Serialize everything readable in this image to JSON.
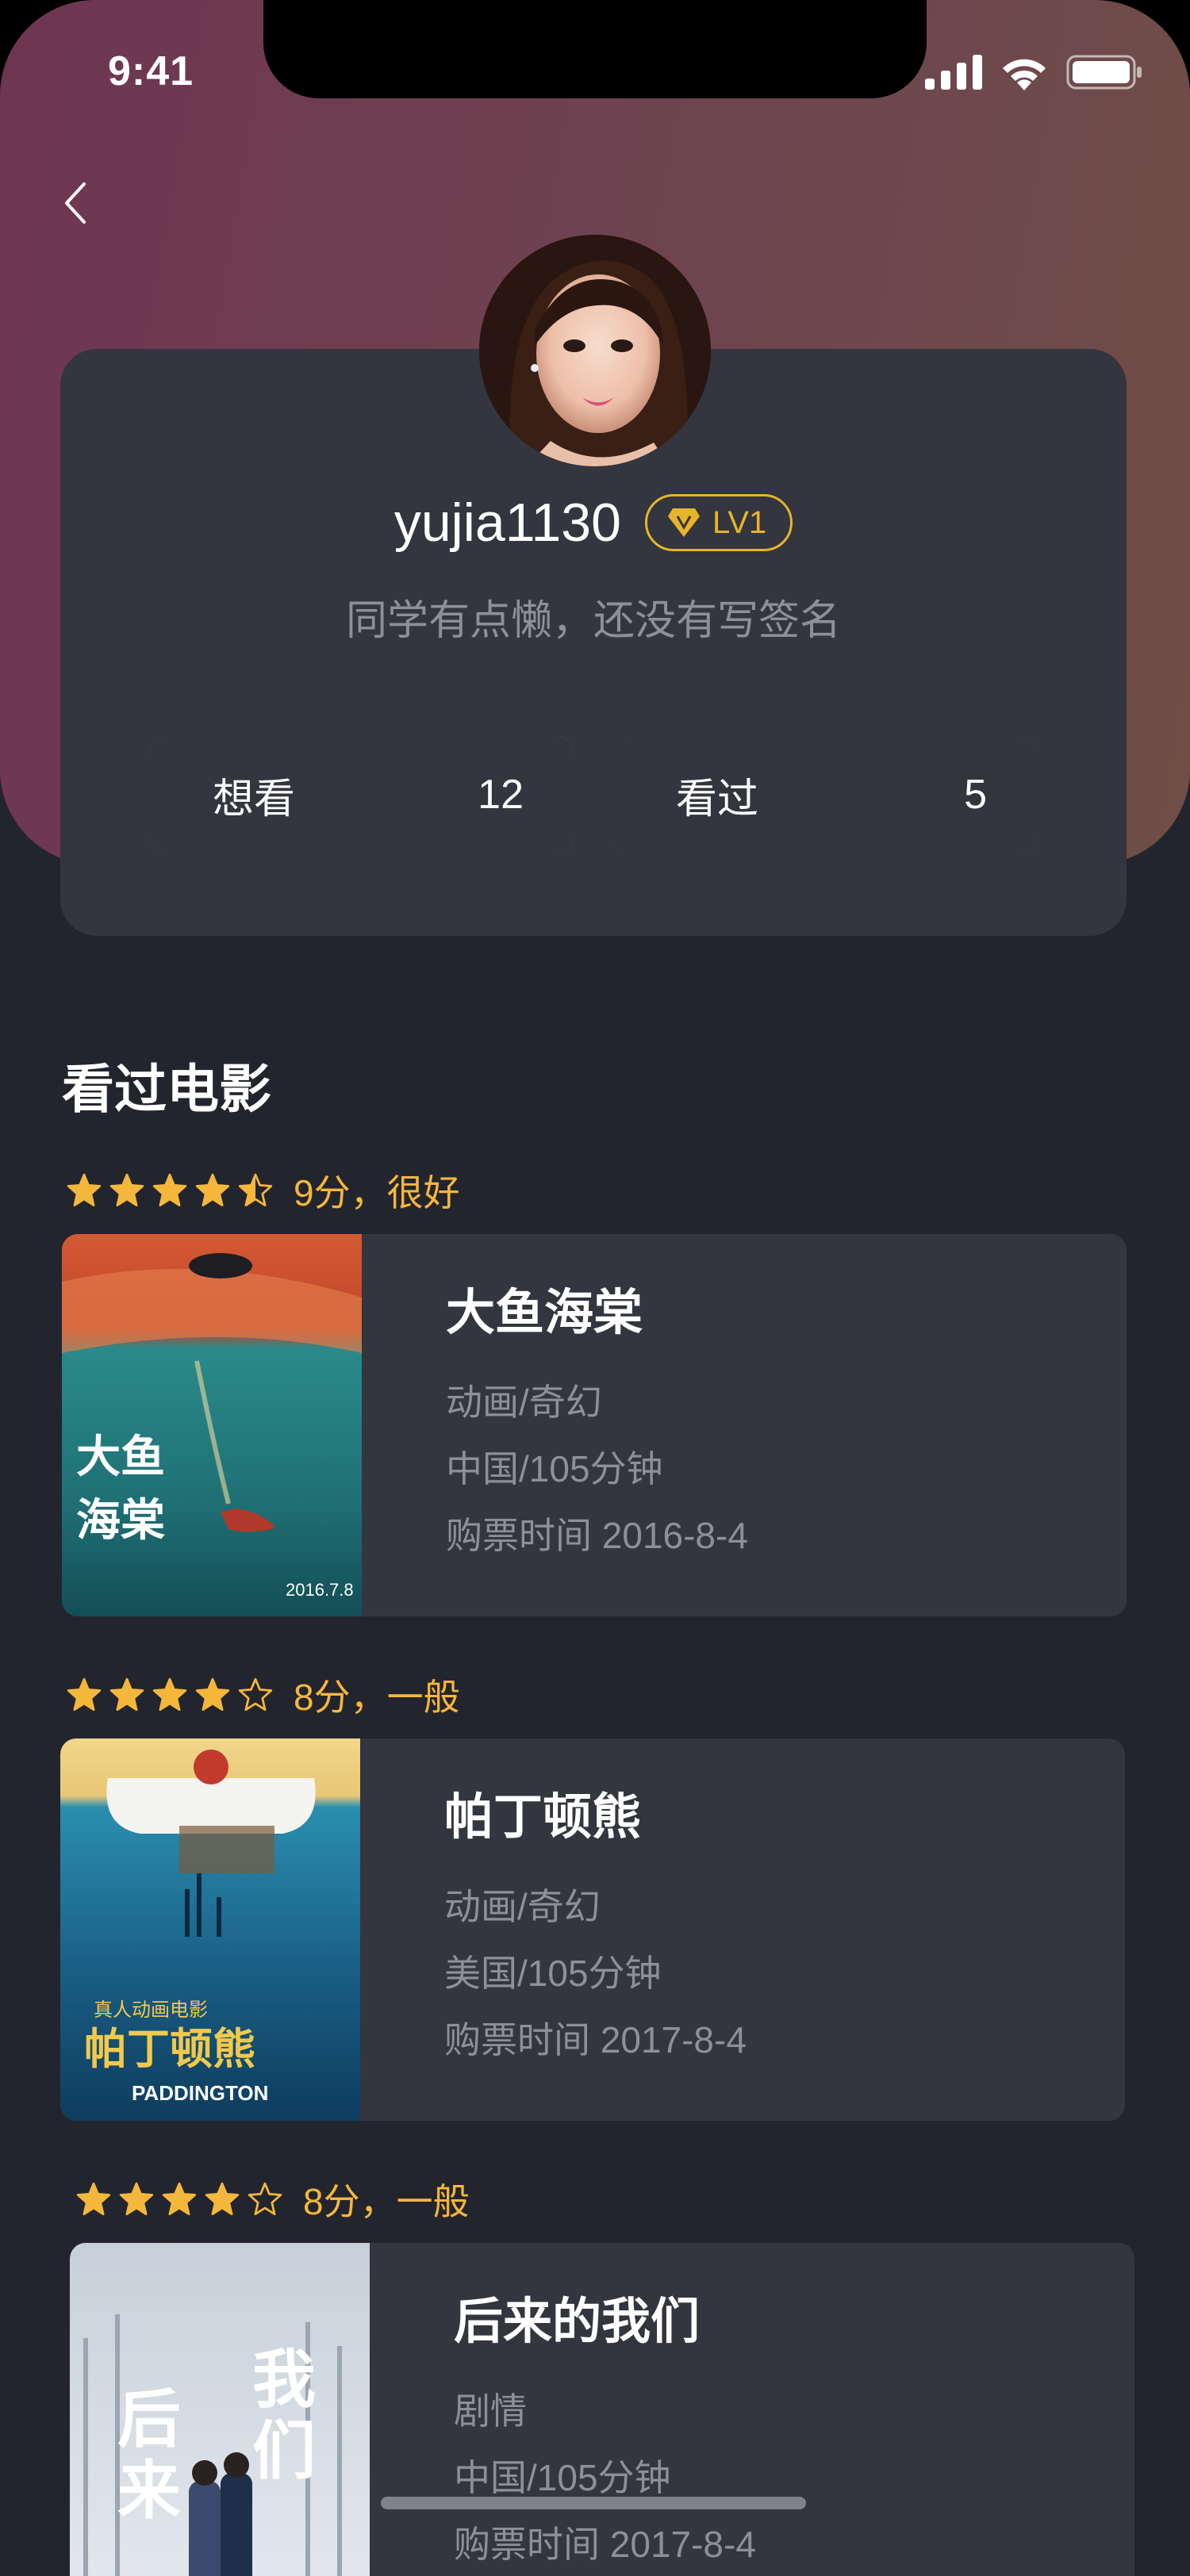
{
  "status_bar": {
    "time": "9:41"
  },
  "profile": {
    "username": "yujia1130",
    "level": "LV1",
    "signature": "同学有点懒，还没有写签名",
    "stats": [
      {
        "label": "想看",
        "count": "12"
      },
      {
        "label": "看过",
        "count": "5"
      }
    ]
  },
  "section": {
    "title": "看过电影"
  },
  "movies": [
    {
      "rating": 4.5,
      "rating_text": "9分，很好",
      "title": "大鱼海棠",
      "genre": "动画/奇幻",
      "region_duration": "中国/105分钟",
      "purchase": "购票时间 2016-8-4"
    },
    {
      "rating": 4,
      "rating_text": "8分，一般",
      "title": "帕丁顿熊",
      "genre": "动画/奇幻",
      "region_duration": "美国/105分钟",
      "purchase": "购票时间 2017-8-4"
    },
    {
      "rating": 4,
      "rating_text": "8分，一般",
      "title": "后来的我们",
      "genre": "剧情",
      "region_duration": "中国/105分钟",
      "purchase": "购票时间 2017-8-4"
    }
  ],
  "posters": {
    "dayu": {
      "title_art": "大鱼海棠",
      "date": "2016.7.8"
    },
    "paddington": {
      "subtitle": "真人动画电影",
      "title_art": "帕丁顿熊",
      "english": "PADDINGTON"
    },
    "houlai": {
      "title_art": "后来的我们"
    }
  },
  "colors": {
    "background": "#23252e",
    "card": "#33353f",
    "accent_gold": "#f5b73b",
    "muted_text": "#8e8f98"
  }
}
